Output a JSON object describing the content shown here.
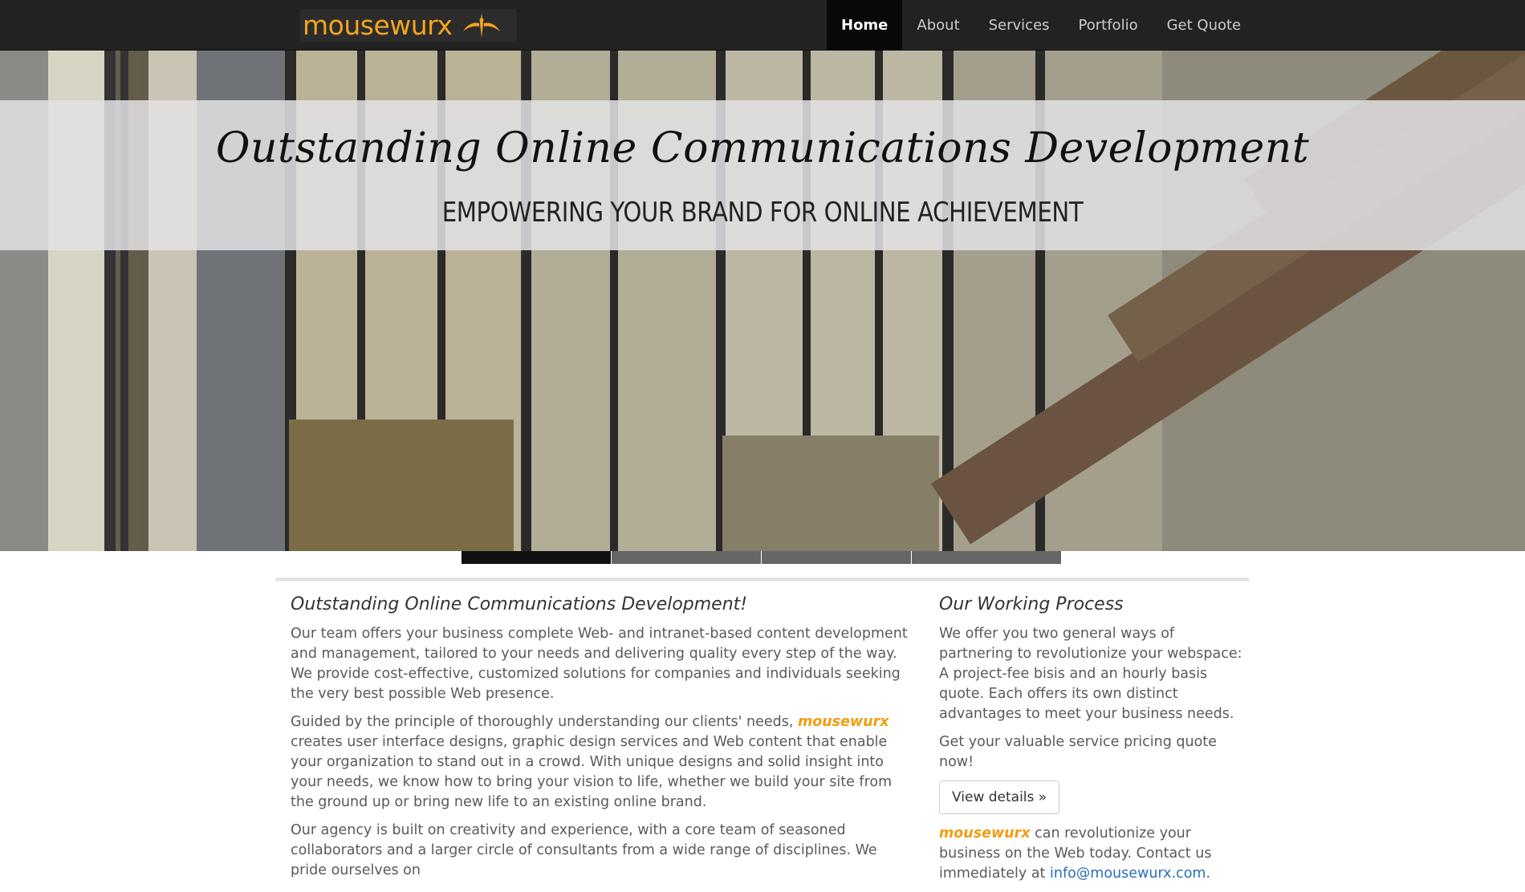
{
  "nav": {
    "logo_text": "mousewurx",
    "items": [
      {
        "label": "Home"
      },
      {
        "label": "About"
      },
      {
        "label": "Services"
      },
      {
        "label": "Portfolio"
      },
      {
        "label": "Get Quote"
      }
    ]
  },
  "hero": {
    "title": "Outstanding Online Communications Development",
    "subtitle": "EMPOWERING YOUR BRAND FOR ONLINE ACHIEVEMENT"
  },
  "carousel": {
    "slides": 4,
    "active": 1
  },
  "main": {
    "heading": "Outstanding Online Communications Development!",
    "p1": "Our team offers your business complete Web- and intranet-based content development and management, tailored to your needs and delivering quality every step of the way. We provide cost-effective, customized solutions for companies and individuals seeking the very best possible Web presence.",
    "p2_pre": "Guided by the principle of thoroughly understanding our clients' needs, ",
    "p2_brand": "mousewurx",
    "p2_post": " creates user interface designs, graphic design services and Web content that enable your organization to stand out in a crowd. With unique designs and solid insight into your needs, we know how to bring your vision to life, whether we build your site from the ground up or bring new life to an existing online brand.",
    "p3": "Our agency is built on creativity and experience, with a core team of seasoned collaborators and a larger circle of consultants from a wide range of disciplines. We pride ourselves on"
  },
  "sidebar": {
    "heading": "Our Working Process",
    "p1": "We offer you two general ways of partnering to revolutionize your webspace: A project-fee bisis and an hourly basis quote. Each offers its own distinct advantages to meet your business needs.",
    "p2": "Get your valuable service pricing quote now!",
    "button": "View details »",
    "p3_brand": "mousewurx",
    "p3_text": " can revolutionize your business on the Web today. Contact us immediately at ",
    "email": "info@mousewurx.com",
    "p3_end": "."
  },
  "colors": {
    "brand_orange": "#f39c12",
    "navbar": "#222222",
    "link": "#2a6ebb"
  }
}
